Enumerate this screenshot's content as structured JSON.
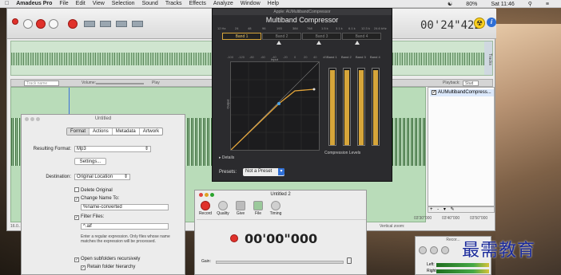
{
  "menubar": {
    "app": "Amadeus Pro",
    "items": [
      "File",
      "Edit",
      "View",
      "Selection",
      "Sound",
      "Tracks",
      "Effects",
      "Analyze",
      "Window",
      "Help"
    ],
    "battery": "80%",
    "clock": "Sat 11:46"
  },
  "main": {
    "timer": "00'24\"422",
    "tracks_tab": "Tracks",
    "track_placeholder": "Track name",
    "volume_label": "Volume:",
    "play_label": "Play",
    "playback_label": "Playback:",
    "playback_value": "Stud",
    "effect_item": "AUMultibandCompress...",
    "effects_bottom": "+ - ▾ ✎",
    "ruler": [
      "03'30\"000",
      "03'40\"000",
      "03'50\"000"
    ],
    "status_left": "16.0...",
    "status_right": "Vertical zoom:"
  },
  "mbc": {
    "titlebar": "Apple: AUMultibandCompressor",
    "title": "Multiband Compressor",
    "freq_scale": [
      "12 Hz",
      "24",
      "48",
      "96",
      "193",
      "384",
      "768",
      "1.5 k",
      "3.1 k",
      "6.1 k",
      "12.3 k",
      "24.6 kHz"
    ],
    "bands": [
      "Band 1",
      "Band 2",
      "Band 3",
      "Band 4"
    ],
    "graph_top": [
      "-100",
      "-120",
      "-80",
      "-60",
      "-40",
      "-20",
      "0",
      "20",
      "40",
      "dB"
    ],
    "input_label": "Input",
    "output_label": "Output",
    "meter_labels": [
      "Band 1",
      "Band 2",
      "Band 3",
      "Band 4"
    ],
    "compression_label": "Compression Levels",
    "details": "Details",
    "presets_label": "Presets:",
    "preset_value": "Not a Preset"
  },
  "dialog": {
    "title": "Untitled",
    "tabs": [
      "Format",
      "Actions",
      "Metadata",
      "Artwork"
    ],
    "resulting_format_label": "Resulting Format:",
    "resulting_format_value": "Mp3",
    "settings_button": "Settings...",
    "destination_label": "Destination:",
    "destination_value": "Original Location",
    "delete_original": "Delete Original",
    "change_name": "Change Name To:",
    "name_pattern": "%name-converted",
    "filter_files": "Filter Files:",
    "filter_value": "^.aif",
    "note": "Enter a regular expression. Only files whose name matches the expression will be processed.",
    "open_subfolders": "Open subfolders recursively",
    "retain_hierarchy": "Retain folder hierarchy"
  },
  "recorder": {
    "title": "Untitled 2",
    "tools": [
      "Record",
      "Quality",
      "Give",
      "File",
      "Timing"
    ],
    "time": "00'00\"000",
    "gain_label": "Gain:"
  },
  "mini": {
    "title": "Recor...",
    "left_label": "Left:",
    "right_label": "Right:"
  },
  "watermark": "最需教育"
}
